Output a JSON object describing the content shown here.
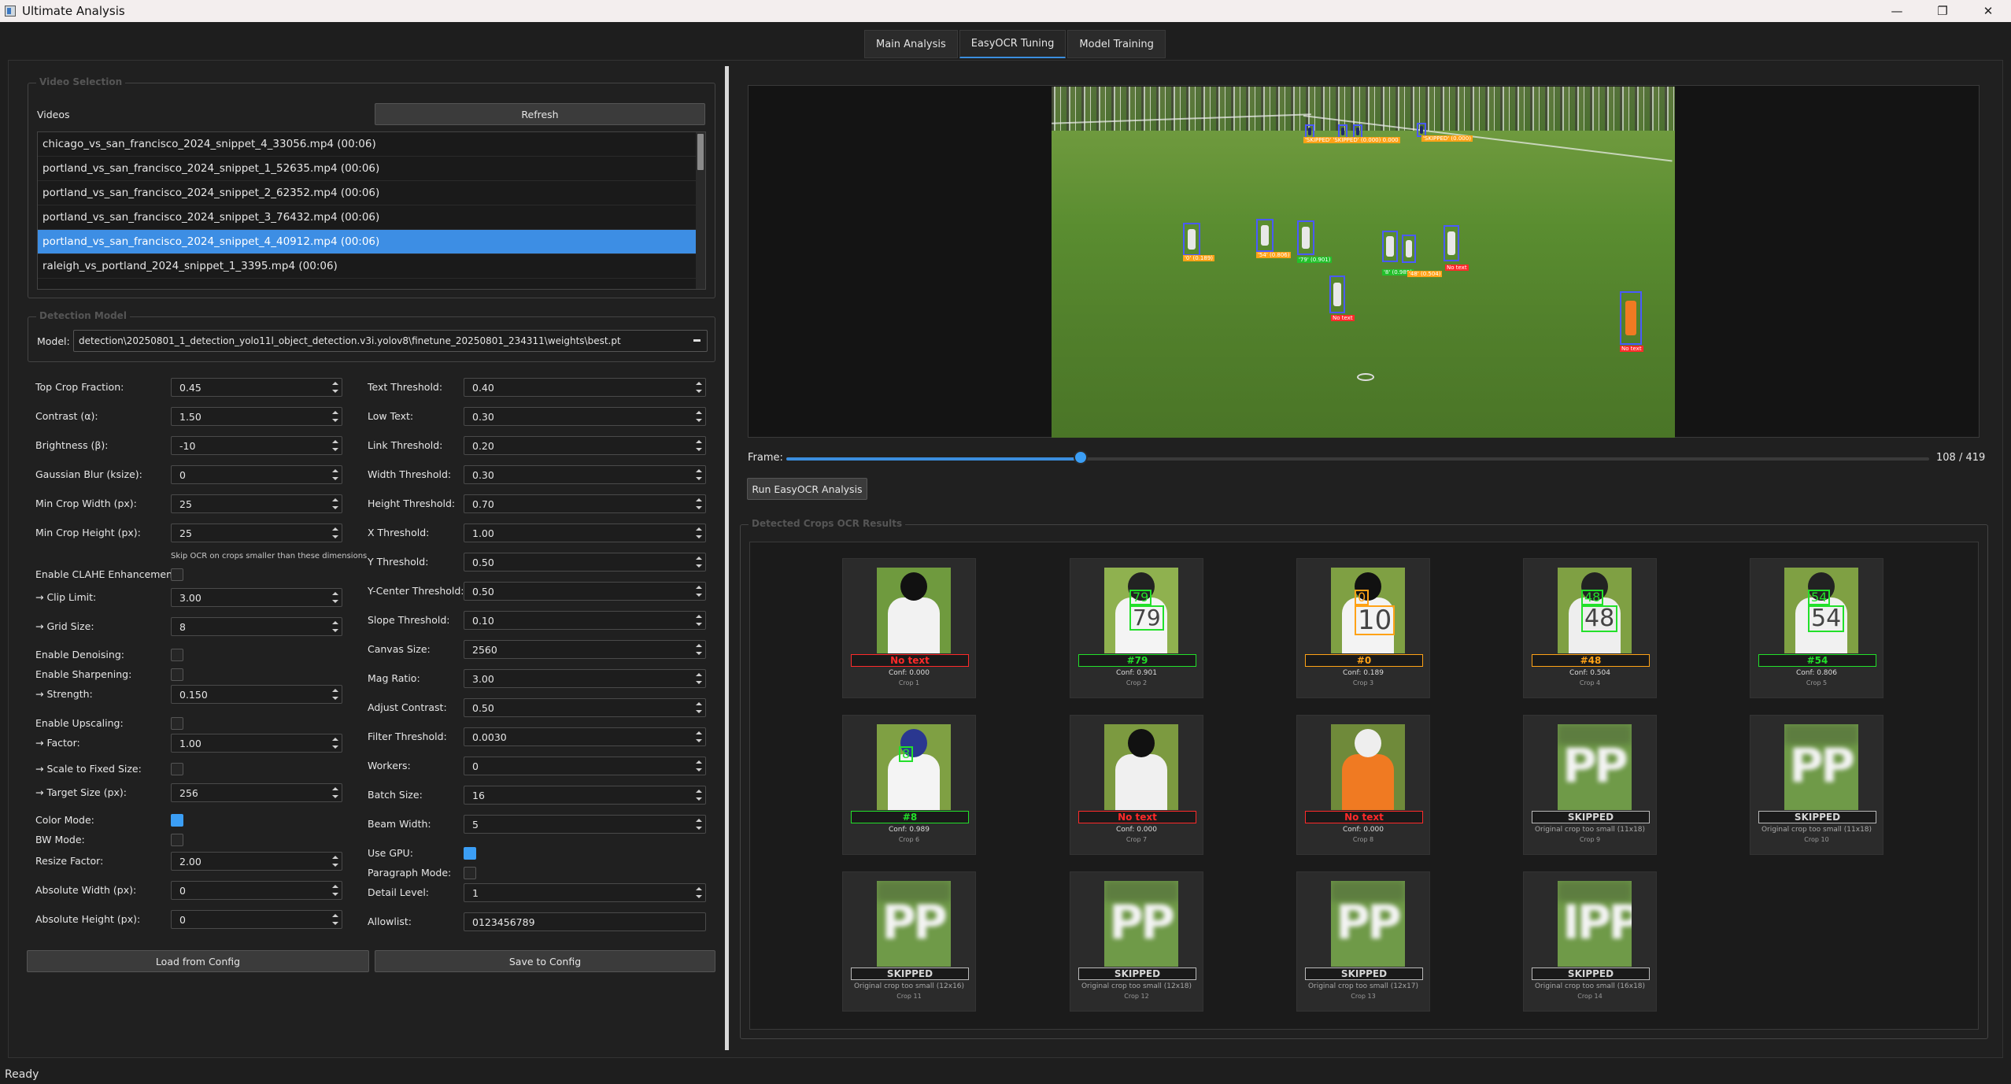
{
  "window": {
    "title": "Ultimate Analysis",
    "min": "—",
    "max": "❐",
    "close": "✕"
  },
  "tabs": [
    "Main Analysis",
    "EasyOCR Tuning",
    "Model Training"
  ],
  "video_selection": {
    "group_title": "Video Selection",
    "videos_label": "Videos",
    "refresh": "Refresh",
    "videos": [
      "chicago_vs_san_francisco_2024_snippet_4_33056.mp4 (00:06)",
      "portland_vs_san_francisco_2024_snippet_1_52635.mp4 (00:06)",
      "portland_vs_san_francisco_2024_snippet_2_62352.mp4 (00:06)",
      "portland_vs_san_francisco_2024_snippet_3_76432.mp4 (00:06)",
      "portland_vs_san_francisco_2024_snippet_4_40912.mp4 (00:06)",
      "raleigh_vs_portland_2024_snippet_1_3395.mp4 (00:06)"
    ],
    "selected_index": 4
  },
  "detection_model": {
    "group_title": "Detection Model",
    "model_label": "Model:",
    "model_value": "detection\\20250801_1_detection_yolo11l_object_detection.v3i.yolov8\\finetune_20250801_234311\\weights\\best.pt"
  },
  "params_left": {
    "top_crop": {
      "label": "Top Crop Fraction:",
      "value": "0.45"
    },
    "contrast": {
      "label": "Contrast (α):",
      "value": "1.50"
    },
    "brightness": {
      "label": "Brightness (β):",
      "value": "-10"
    },
    "blur": {
      "label": "Gaussian Blur (ksize):",
      "value": "0"
    },
    "min_w": {
      "label": "Min Crop Width (px):",
      "value": "25"
    },
    "min_h": {
      "label": "Min Crop Height (px):",
      "value": "25"
    },
    "skip_hint": "Skip OCR on crops smaller than these dimensions",
    "clahe": {
      "label": "Enable CLAHE Enhancement:",
      "checked": false
    },
    "clip": {
      "label": "→ Clip Limit:",
      "value": "3.00"
    },
    "grid": {
      "label": "→ Grid Size:",
      "value": "8"
    },
    "denoise": {
      "label": "Enable Denoising:",
      "checked": false
    },
    "sharpen": {
      "label": "Enable Sharpening:",
      "checked": false
    },
    "strength": {
      "label": "→ Strength:",
      "value": "0.150"
    },
    "upscale": {
      "label": "Enable Upscaling:",
      "checked": false
    },
    "factor": {
      "label": "→ Factor:",
      "value": "1.00"
    },
    "scale_fixed": {
      "label": "→ Scale to Fixed Size:",
      "checked": false
    },
    "target": {
      "label": "→ Target Size (px):",
      "value": "256"
    },
    "color_mode": {
      "label": "Color Mode:",
      "checked": true
    },
    "bw_mode": {
      "label": "BW Mode:",
      "checked": false
    },
    "resize": {
      "label": "Resize Factor:",
      "value": "2.00"
    },
    "abs_w": {
      "label": "Absolute Width (px):",
      "value": "0"
    },
    "abs_h": {
      "label": "Absolute Height (px):",
      "value": "0"
    }
  },
  "params_right": {
    "text_th": {
      "label": "Text Threshold:",
      "value": "0.40"
    },
    "low_text": {
      "label": "Low Text:",
      "value": "0.30"
    },
    "link_th": {
      "label": "Link Threshold:",
      "value": "0.20"
    },
    "width_th": {
      "label": "Width Threshold:",
      "value": "0.30"
    },
    "height_th": {
      "label": "Height Threshold:",
      "value": "0.70"
    },
    "x_th": {
      "label": "X Threshold:",
      "value": "1.00"
    },
    "y_th": {
      "label": "Y Threshold:",
      "value": "0.50"
    },
    "yc_th": {
      "label": "Y-Center Threshold:",
      "value": "0.50"
    },
    "slope_th": {
      "label": "Slope Threshold:",
      "value": "0.10"
    },
    "canvas": {
      "label": "Canvas Size:",
      "value": "2560"
    },
    "mag": {
      "label": "Mag Ratio:",
      "value": "3.00"
    },
    "adj_contrast": {
      "label": "Adjust Contrast:",
      "value": "0.50"
    },
    "filter_th": {
      "label": "Filter Threshold:",
      "value": "0.0030"
    },
    "workers": {
      "label": "Workers:",
      "value": "0"
    },
    "batch": {
      "label": "Batch Size:",
      "value": "16"
    },
    "beam": {
      "label": "Beam Width:",
      "value": "5"
    },
    "gpu": {
      "label": "Use GPU:",
      "checked": true
    },
    "paragraph": {
      "label": "Paragraph Mode:",
      "checked": false
    },
    "detail": {
      "label": "Detail Level:",
      "value": "1"
    },
    "allowlist": {
      "label": "Allowlist:",
      "value": "0123456789"
    }
  },
  "buttons": {
    "load": "Load from Config",
    "save": "Save to Config",
    "run": "Run EasyOCR Analysis"
  },
  "frame": {
    "label": "Frame:",
    "current": 108,
    "total": 419,
    "display": "108 / 419"
  },
  "overlay_tags": {
    "t1": "'SKIPPED' 'SKIPPED' (0.000) 0.000",
    "t2": "'SKIPPED' (0.000)",
    "t3": "'0' (0.189)",
    "t4": "'54' (0.806)",
    "t5": "'79' (0.901)",
    "t6": "'8' (0.989)",
    "t7": "'48' (0.504)",
    "t8": "No text",
    "t9": "No text",
    "t10": "No text"
  },
  "crops_group_title": "Detected Crops  OCR Results",
  "crops": [
    {
      "result": "No text",
      "conf": "Conf: 0.000",
      "name": "Crop 1",
      "kind": "red"
    },
    {
      "result": "#79",
      "conf": "Conf: 0.901",
      "name": "Crop 2",
      "kind": "green"
    },
    {
      "result": "#0",
      "conf": "Conf: 0.189",
      "name": "Crop 3",
      "kind": "orange"
    },
    {
      "result": "#48",
      "conf": "Conf: 0.504",
      "name": "Crop 4",
      "kind": "orange"
    },
    {
      "result": "#54",
      "conf": "Conf: 0.806",
      "name": "Crop 5",
      "kind": "green"
    },
    {
      "result": "#8",
      "conf": "Conf: 0.989",
      "name": "Crop 6",
      "kind": "green"
    },
    {
      "result": "No text",
      "conf": "Conf: 0.000",
      "name": "Crop 7",
      "kind": "red"
    },
    {
      "result": "No text",
      "conf": "Conf: 0.000",
      "name": "Crop 8",
      "kind": "red"
    },
    {
      "result": "SKIPPED",
      "conf": "Original crop too small (11x18)",
      "name": "Crop 9",
      "kind": "gray"
    },
    {
      "result": "SKIPPED",
      "conf": "Original crop too small (11x18)",
      "name": "Crop 10",
      "kind": "gray"
    },
    {
      "result": "SKIPPED",
      "conf": "Original crop too small (12x16)",
      "name": "Crop 11",
      "kind": "gray"
    },
    {
      "result": "SKIPPED",
      "conf": "Original crop too small (12x18)",
      "name": "Crop 12",
      "kind": "gray"
    },
    {
      "result": "SKIPPED",
      "conf": "Original crop too small (12x17)",
      "name": "Crop 13",
      "kind": "gray"
    },
    {
      "result": "SKIPPED",
      "conf": "Original crop too small (16x18)",
      "name": "Crop 14",
      "kind": "gray"
    }
  ],
  "crop_thumb_text": {
    "c2a": "79",
    "c2b": "79",
    "c3a": "0",
    "c3b": "10",
    "c4a": "48",
    "c4b": "48",
    "c5a": "54",
    "c5b": "54",
    "c6": "8",
    "pp": "PP",
    "ipp": "IPP"
  },
  "colors": {
    "accent": "#3b8ede",
    "green": "#22e02a",
    "red": "#ff2a2a",
    "orange": "#ffa216",
    "gray": "#b9b9b9"
  },
  "status": "Ready"
}
